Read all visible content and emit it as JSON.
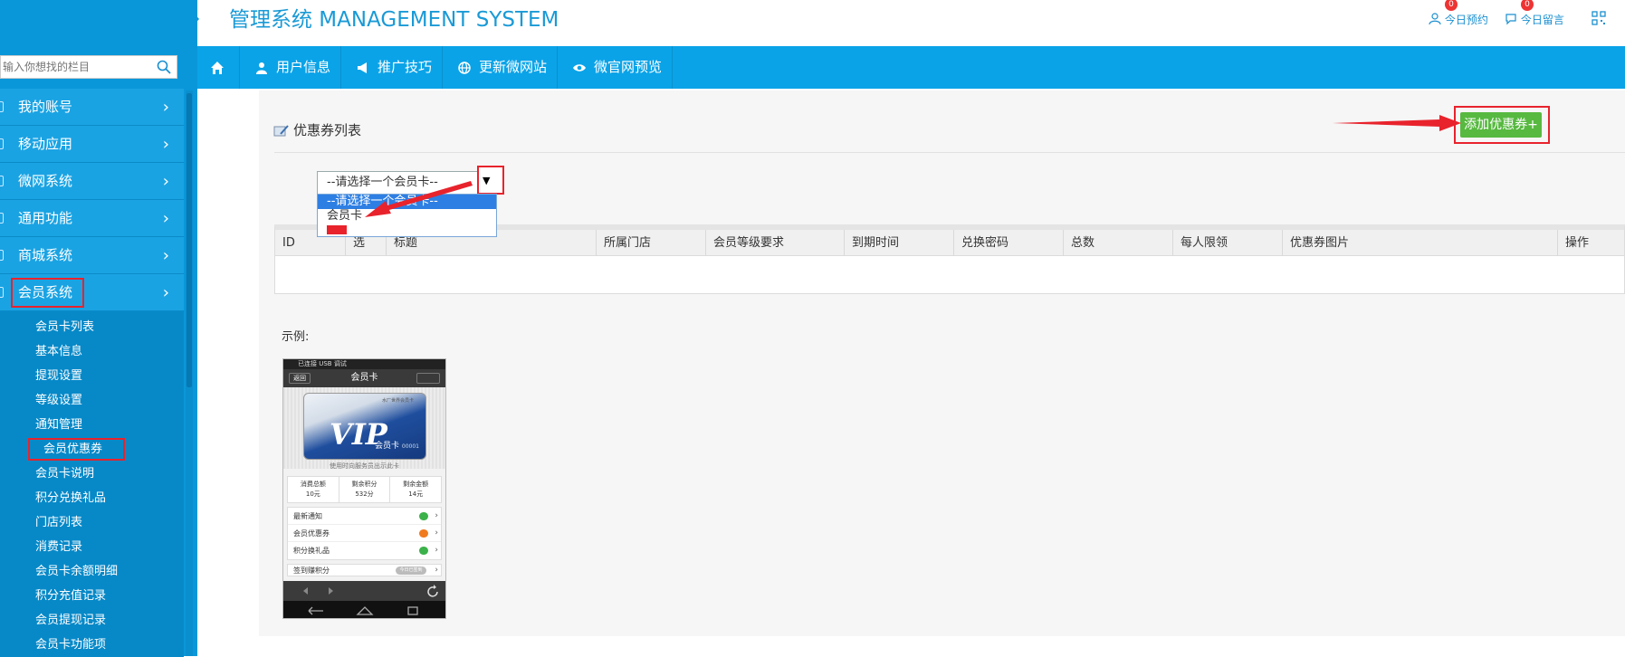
{
  "header": {
    "title": "管理系统 MANAGEMENT SYSTEM",
    "actions": [
      {
        "label": "今日预约",
        "badge": "0"
      },
      {
        "label": "今日留言",
        "badge": "0"
      }
    ]
  },
  "sidebar": {
    "search_placeholder": "输入你想找的栏目",
    "menu": [
      {
        "label": "我的账号"
      },
      {
        "label": "移动应用"
      },
      {
        "label": "微网系统"
      },
      {
        "label": "通用功能"
      },
      {
        "label": "商城系统"
      },
      {
        "label": "会员系统"
      }
    ],
    "chevron": "›",
    "submenu": [
      "会员卡列表",
      "基本信息",
      "提现设置",
      "等级设置",
      "通知管理",
      "会员优惠券",
      "会员卡说明",
      "积分兑换礼品",
      "门店列表",
      "消费记录",
      "会员卡余额明细",
      "积分充值记录",
      "会员提现记录",
      "会员卡功能项"
    ]
  },
  "navbar": {
    "items": [
      "用户信息",
      "推广技巧",
      "更新微网站",
      "微官网预览"
    ]
  },
  "main": {
    "heading": "优惠券列表",
    "add_button": "添加优惠券+",
    "select": {
      "value": "--请选择一个会员卡--",
      "arrow": "▼",
      "options": [
        "--请选择一个会员卡--",
        "会员卡"
      ]
    },
    "table": {
      "columns": [
        "ID",
        "选",
        "标题",
        "所属门店",
        "会员等级要求",
        "到期时间",
        "兑换密码",
        "总数",
        "每人限领",
        "优惠券图片",
        "操作"
      ]
    },
    "example_label": "示例:"
  },
  "phone": {
    "status": "已连接 USB 调试",
    "back": "返回",
    "title": "会员卡",
    "card_top": "水厂世界会员卡",
    "card_big": "VIP",
    "card_sub": "会员卡",
    "card_no": "00001",
    "hint": "使用时向服务员出示此卡",
    "stats": [
      {
        "label": "消费总额",
        "value": "10元"
      },
      {
        "label": "剩余积分",
        "value": "532分"
      },
      {
        "label": "剩余金额",
        "value": "14元"
      }
    ],
    "list": [
      {
        "label": "最新通知",
        "color": "#3cb24a"
      },
      {
        "label": "会员优惠券",
        "color": "#f07b1e"
      },
      {
        "label": "积分换礼品",
        "color": "#3cb24a"
      }
    ],
    "sign_label": "签到赚积分",
    "sign_pill": "今日已签到"
  },
  "colors": {
    "accent": "#0aa3e8",
    "sidebar": "#0a97d9",
    "green": "#57b940",
    "red": "#e8232c"
  }
}
